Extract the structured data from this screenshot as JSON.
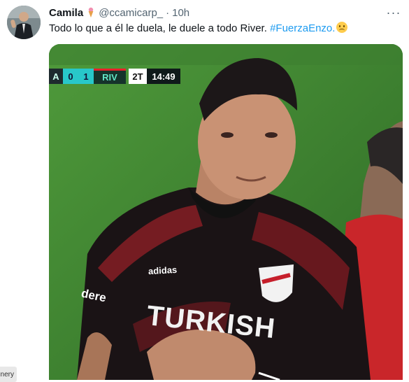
{
  "tweet": {
    "display_name": "Camila",
    "handle": "@ccamicarp_",
    "separator": "·",
    "time": "10h",
    "text": "Todo lo que a él le duela, le duele a todo River.",
    "hashtag": "#FuerzaEnzo.",
    "emoji": "sad-face-emoji"
  },
  "media": {
    "scoreboard": {
      "edge": "A",
      "score_home": "0",
      "score_away": "1",
      "team": "RIV",
      "half": "2T",
      "clock": "14:49"
    },
    "jersey_brand": "adidas",
    "sponsor": "TURKISH",
    "sleeve": "dere"
  },
  "chip": {
    "label": "nery"
  },
  "colors": {
    "hashtag": "#1d9bf0",
    "secondary_text": "#536471"
  }
}
